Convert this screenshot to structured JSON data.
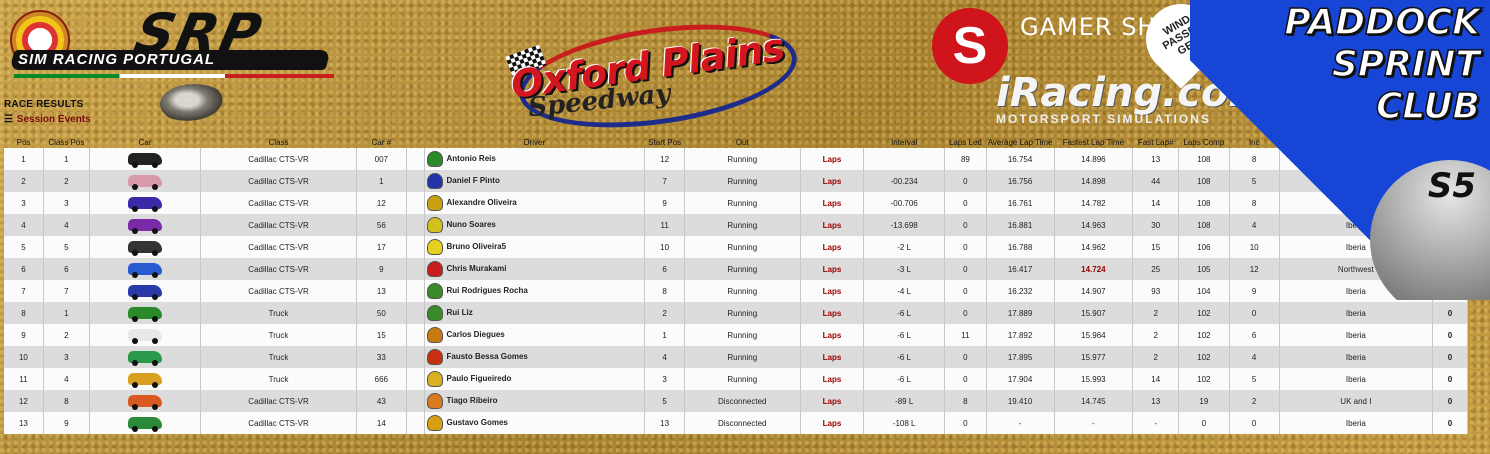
{
  "header": {
    "srp_logo_text": "SRP",
    "srp_subtitle": "SIM RACING PORTUGAL",
    "race_results": "RACE RESULTS",
    "session_events": "Session Events",
    "oxford_name": "Oxford Plains",
    "oxford_sub": "Speedway",
    "gamer_shop_mark": "S",
    "gamer_shop_text": "GAMER SHOP",
    "wind_passenger": "WIND PASSEN GER",
    "iracing_brand": "iRacing.com",
    "iracing_tag": "MOTORSPORT SIMULATIONS",
    "banner_title": "PADDOCK SPRINT CLUB",
    "banner_season": "S5"
  },
  "colors": {
    "gold_background": "#b8923a",
    "banner_blue": "#1746d6",
    "laps_red": "#a00000",
    "row_light": "#fbfbfb",
    "row_dark": "#dcdcdc"
  },
  "table": {
    "headers": [
      "Pos",
      "Class Pos",
      "Car",
      "Class",
      "Car #",
      "",
      "Driver",
      "Start Pos",
      "Out",
      "",
      "Interval",
      "Laps Led",
      "Average Lap Time",
      "Fastest Lap Time",
      "Fast Lap#",
      "Laps Comp",
      "Inc",
      "",
      ""
    ],
    "rows": [
      {
        "pos": "1",
        "class_pos": "1",
        "car_color": "#222",
        "class": "Cadillac CTS-VR",
        "num": "007",
        "helmet": "#2a8a2a",
        "driver": "Antonio Reis",
        "start": "12",
        "out": "Running",
        "laps": "Laps",
        "interval": "",
        "led": "89",
        "avg": "16.754",
        "fast": "14.896",
        "fast_lap": "13",
        "comp": "108",
        "inc": "8",
        "club": "",
        "extra": "",
        "fast_red": false
      },
      {
        "pos": "2",
        "class_pos": "2",
        "car_color": "#d89aa8",
        "class": "Cadillac CTS-VR",
        "num": "1",
        "helmet": "#2233aa",
        "driver": "Daniel F Pinto",
        "start": "7",
        "out": "Running",
        "laps": "Laps",
        "interval": "-00.234",
        "led": "0",
        "avg": "16.756",
        "fast": "14.898",
        "fast_lap": "44",
        "comp": "108",
        "inc": "5",
        "club": "",
        "extra": "",
        "fast_red": false
      },
      {
        "pos": "3",
        "class_pos": "3",
        "car_color": "#3a2aa8",
        "class": "Cadillac CTS-VR",
        "num": "12",
        "helmet": "#c8a010",
        "driver": "Alexandre Oliveira",
        "start": "9",
        "out": "Running",
        "laps": "Laps",
        "interval": "-00.706",
        "led": "0",
        "avg": "16.761",
        "fast": "14.782",
        "fast_lap": "14",
        "comp": "108",
        "inc": "8",
        "club": "Iberia",
        "extra": "",
        "fast_red": false
      },
      {
        "pos": "4",
        "class_pos": "4",
        "car_color": "#7a2aa8",
        "class": "Cadillac CTS-VR",
        "num": "56",
        "helmet": "#d0c020",
        "driver": "Nuno Soares",
        "start": "11",
        "out": "Running",
        "laps": "Laps",
        "interval": "-13.698",
        "led": "0",
        "avg": "16.881",
        "fast": "14.963",
        "fast_lap": "30",
        "comp": "108",
        "inc": "4",
        "club": "Iberia",
        "extra": "",
        "fast_red": false
      },
      {
        "pos": "5",
        "class_pos": "5",
        "car_color": "#333",
        "class": "Cadillac CTS-VR",
        "num": "17",
        "helmet": "#e8d020",
        "driver": "Bruno Oliveira5",
        "start": "10",
        "out": "Running",
        "laps": "Laps",
        "interval": "-2 L",
        "led": "0",
        "avg": "16.788",
        "fast": "14.962",
        "fast_lap": "15",
        "comp": "106",
        "inc": "10",
        "club": "Iberia",
        "extra": "",
        "fast_red": false
      },
      {
        "pos": "6",
        "class_pos": "6",
        "car_color": "#2a5ad0",
        "class": "Cadillac CTS-VR",
        "num": "9",
        "helmet": "#c81e1e",
        "driver": "Chris Murakami",
        "start": "6",
        "out": "Running",
        "laps": "Laps",
        "interval": "-3 L",
        "led": "0",
        "avg": "16.417",
        "fast": "14.724",
        "fast_lap": "25",
        "comp": "105",
        "inc": "12",
        "club": "Northwest",
        "extra": "",
        "fast_red": true
      },
      {
        "pos": "7",
        "class_pos": "7",
        "car_color": "#2a3aa8",
        "class": "Cadillac CTS-VR",
        "num": "13",
        "helmet": "#3a8a2a",
        "driver": "Rui Rodrigues Rocha",
        "start": "8",
        "out": "Running",
        "laps": "Laps",
        "interval": "-4 L",
        "led": "0",
        "avg": "16.232",
        "fast": "14.907",
        "fast_lap": "93",
        "comp": "104",
        "inc": "9",
        "club": "Iberia",
        "extra": "0",
        "fast_red": false
      },
      {
        "pos": "8",
        "class_pos": "1",
        "car_color": "#2a8a2a",
        "class": "Truck",
        "num": "50",
        "helmet": "#3a8a2a",
        "driver": "Rui Liz",
        "start": "2",
        "out": "Running",
        "laps": "Laps",
        "interval": "-6 L",
        "led": "0",
        "avg": "17.889",
        "fast": "15.907",
        "fast_lap": "2",
        "comp": "102",
        "inc": "0",
        "club": "Iberia",
        "extra": "0",
        "fast_red": false
      },
      {
        "pos": "9",
        "class_pos": "2",
        "car_color": "#e8e8e8",
        "class": "Truck",
        "num": "15",
        "helmet": "#c87a10",
        "driver": "Carlos Diegues",
        "start": "1",
        "out": "Running",
        "laps": "Laps",
        "interval": "-6 L",
        "led": "11",
        "avg": "17.892",
        "fast": "15.964",
        "fast_lap": "2",
        "comp": "102",
        "inc": "6",
        "club": "Iberia",
        "extra": "0",
        "fast_red": false
      },
      {
        "pos": "10",
        "class_pos": "3",
        "car_color": "#2a9a4a",
        "class": "Truck",
        "num": "33",
        "helmet": "#c83010",
        "driver": "Fausto Bessa Gomes",
        "start": "4",
        "out": "Running",
        "laps": "Laps",
        "interval": "-6 L",
        "led": "0",
        "avg": "17.895",
        "fast": "15.977",
        "fast_lap": "2",
        "comp": "102",
        "inc": "4",
        "club": "Iberia",
        "extra": "0",
        "fast_red": false
      },
      {
        "pos": "11",
        "class_pos": "4",
        "car_color": "#d8a020",
        "class": "Truck",
        "num": "666",
        "helmet": "#d8b020",
        "driver": "Paulo Figueiredo",
        "start": "3",
        "out": "Running",
        "laps": "Laps",
        "interval": "-6 L",
        "led": "0",
        "avg": "17.904",
        "fast": "15.993",
        "fast_lap": "14",
        "comp": "102",
        "inc": "5",
        "club": "Iberia",
        "extra": "0",
        "fast_red": false
      },
      {
        "pos": "12",
        "class_pos": "8",
        "car_color": "#d85a20",
        "class": "Cadillac CTS-VR",
        "num": "43",
        "helmet": "#d87a20",
        "driver": "Tiago Ribeiro",
        "start": "5",
        "out": "Disconnected",
        "laps": "Laps",
        "interval": "-89 L",
        "led": "8",
        "avg": "19.410",
        "fast": "14.745",
        "fast_lap": "13",
        "comp": "19",
        "inc": "2",
        "club": "UK and I",
        "extra": "0",
        "fast_red": false
      },
      {
        "pos": "13",
        "class_pos": "9",
        "car_color": "#2a8a3a",
        "class": "Cadillac CTS-VR",
        "num": "14",
        "helmet": "#d8a010",
        "driver": "Gustavo Gomes",
        "start": "13",
        "out": "Disconnected",
        "laps": "Laps",
        "interval": "-108 L",
        "led": "0",
        "avg": "-",
        "fast": "-",
        "fast_lap": "-",
        "comp": "0",
        "inc": "0",
        "club": "Iberia",
        "extra": "0",
        "fast_red": false
      }
    ]
  }
}
